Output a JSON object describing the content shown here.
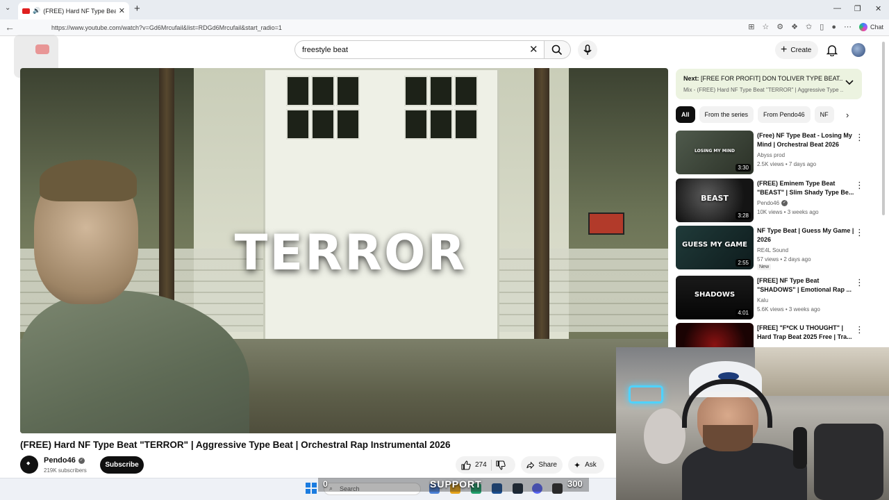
{
  "browser": {
    "tab_title": "(FREE) Hard NF Type Beat \"TE",
    "url": "https://www.youtube.com/watch?v=Gd6Mrcufail&list=RDGd6Mrcufail&start_radio=1",
    "chat_label": "Chat"
  },
  "header": {
    "search_value": "freestyle beat",
    "create_label": "Create"
  },
  "video": {
    "overlay_text": "TERROR",
    "title": "(FREE) Hard NF Type Beat \"TERROR\" | Aggressive Type Beat | Orchestral Rap Instrumental 2026",
    "channel_name": "Pendo46",
    "subscribers": "219K subscribers",
    "subscribe_label": "Subscribe",
    "likes": "274",
    "share_label": "Share",
    "ask_label": "Ask"
  },
  "sidebar": {
    "next_prefix": "Next:",
    "next_title": "[FREE FOR PROFIT] DON TOLIVER TYPE BEAT...",
    "next_sub": "Mix - (FREE) Hard NF Type Beat \"TERROR\" | Aggressive Type ...",
    "chips": [
      "All",
      "From the series",
      "From Pendo46",
      "NF"
    ],
    "recommendations": [
      {
        "title": "(Free) NF Type Beat - Losing My Mind | Orchestral Beat 2026",
        "channel": "Abyss prod",
        "meta": "2.5K views • 7 days ago",
        "duration": "3:30",
        "thumb_text": "LOSING MY MIND",
        "verified": false,
        "badge": ""
      },
      {
        "title": "(FREE) Eminem Type Beat \"BEAST\" | Slim Shady Type Be...",
        "channel": "Pendo46",
        "meta": "10K views • 3 weeks ago",
        "duration": "3:28",
        "thumb_text": "BEAST",
        "verified": true,
        "badge": ""
      },
      {
        "title": "NF Type Beat | Guess My Game | 2026",
        "channel": "RE4L Sound",
        "meta": "57 views • 2 days ago",
        "duration": "2:55",
        "thumb_text": "GUESS MY GAME",
        "verified": false,
        "badge": "New"
      },
      {
        "title": "[FREE] NF Type Beat \"SHADOWS\" | Emotional Rap ...",
        "channel": "Kalu",
        "meta": "5.6K views • 3 weeks ago",
        "duration": "4:01",
        "thumb_text": "SHADOWS",
        "verified": false,
        "badge": ""
      },
      {
        "title": "[FREE] \"F*CK U THOUGHT\" | Hard Trap Beat 2025 Free | Tra...",
        "channel": "",
        "meta": "",
        "duration": "",
        "thumb_text": "",
        "verified": false,
        "badge": ""
      }
    ]
  },
  "taskbar": {
    "search_placeholder": "Search",
    "support_left": "0",
    "support_text": "SUPPORT",
    "support_right": "300"
  },
  "icons": {
    "back": "back-arrow-icon",
    "search": "search-icon",
    "mic": "mic-icon",
    "bell": "bell-icon",
    "like": "thumbs-up-icon",
    "dislike": "thumbs-down-icon",
    "share": "share-icon",
    "ask": "sparkle-icon"
  },
  "colors": {
    "subscribe_bg": "#0f0f0f",
    "next_card_bg": "#ecf3e0",
    "youtube_red": "#e02020"
  }
}
